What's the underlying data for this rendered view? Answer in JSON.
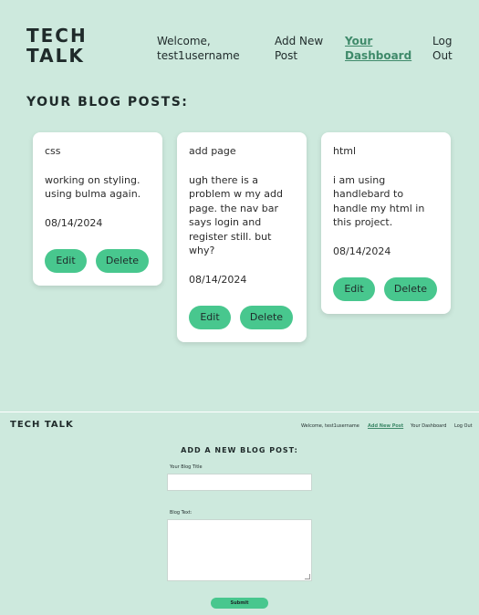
{
  "dashboard": {
    "logo_line1": "TECH",
    "logo_line2": "TALK",
    "nav": {
      "welcome": "Welcome, test1username",
      "add_post": "Add New Post",
      "dashboard": "Your Dashboard",
      "logout": "Log Out"
    },
    "section_title": "YOUR BLOG POSTS:",
    "posts": [
      {
        "title": "css",
        "body": "working on styling. using bulma again.",
        "date": "08/14/2024",
        "edit_label": "Edit",
        "delete_label": "Delete"
      },
      {
        "title": "add page",
        "body": "ugh there is a problem w my add page. the nav bar says login and register still. but why?",
        "date": "08/14/2024",
        "edit_label": "Edit",
        "delete_label": "Delete"
      },
      {
        "title": "html",
        "body": "i am using handlebard to handle my html in this project.",
        "date": "08/14/2024",
        "edit_label": "Edit",
        "delete_label": "Delete"
      }
    ]
  },
  "add_page": {
    "logo": "TECH TALK",
    "nav": {
      "welcome": "Welcome, test1username",
      "add_post": "Add New Post",
      "dashboard": "Your Dashboard",
      "logout": "Log Out"
    },
    "form_title": "ADD A NEW BLOG POST:",
    "title_label": "Your Blog Title",
    "text_label": "Blog Text:",
    "submit_label": "Submit"
  },
  "colors": {
    "background": "#cde9dd",
    "accent": "#48c78e",
    "active_link": "#3f8a6a"
  }
}
